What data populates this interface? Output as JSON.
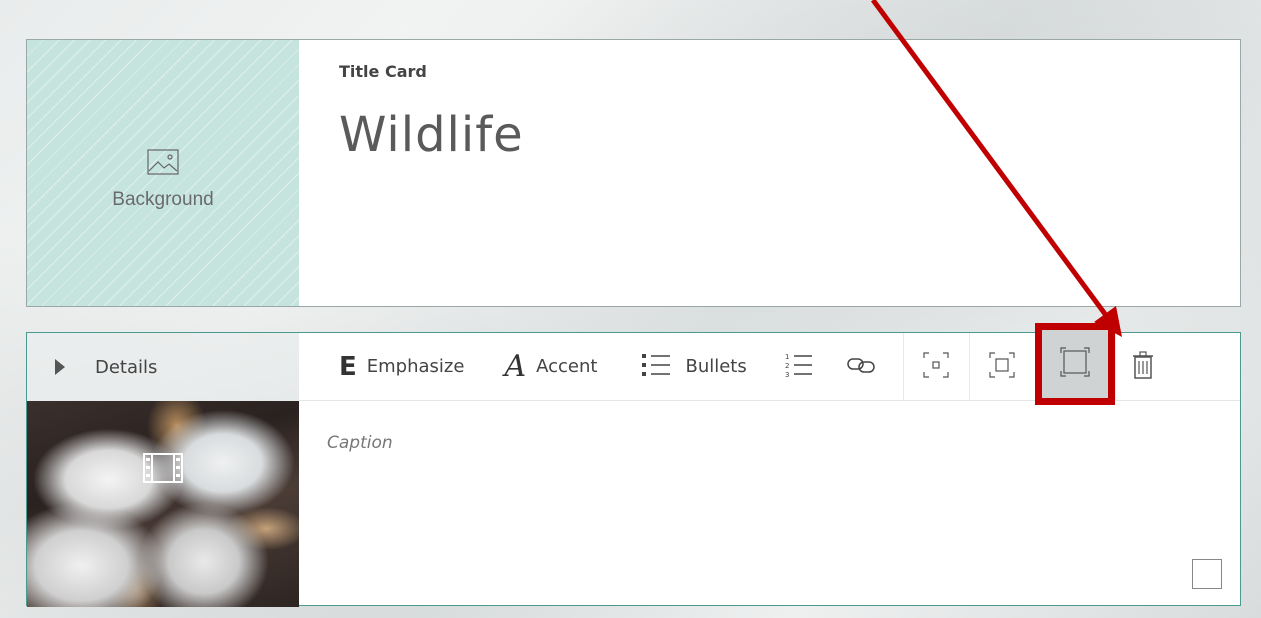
{
  "title_card": {
    "background_label": "Background",
    "card_type": "Title Card",
    "title": "Wildlife"
  },
  "details_card": {
    "header_label": "Details",
    "caption_placeholder": "Caption",
    "toolbar": {
      "emphasize": {
        "glyph": "E",
        "label": "Emphasize"
      },
      "accent": {
        "glyph": "A",
        "label": "Accent"
      },
      "bullets": {
        "label": "Bullets"
      },
      "numbered_icon": "numbered-list-icon",
      "link_icon": "link-icon",
      "size_buttons": [
        "small-size-icon",
        "medium-size-icon",
        "large-size-icon"
      ],
      "delete_icon": "trash-icon"
    },
    "media_icon": "film-icon"
  },
  "colors": {
    "background_tile": "#c5e4de",
    "highlight": "#c00000",
    "card_border": "#4a9a8f"
  }
}
